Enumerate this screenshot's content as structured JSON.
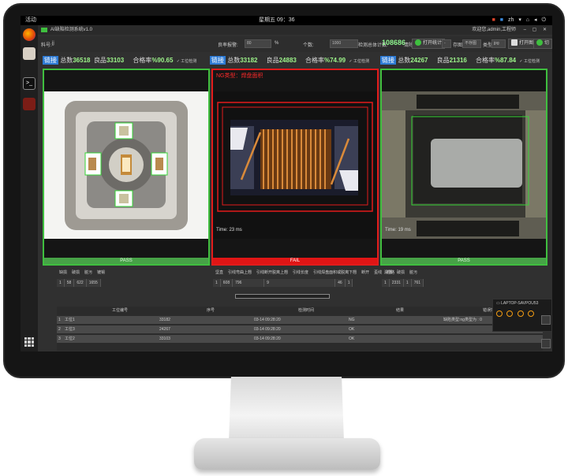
{
  "os": {
    "activities": "活动",
    "clock": "星期五 09：36",
    "tray_items": [
      "zh",
      "▾"
    ]
  },
  "app": {
    "title": "AI缺陷检测系统v1.0",
    "user": "欢迎您,admin,工程师",
    "window_controls": "– ▢ ✕",
    "toolbar": {
      "part_label": "料号:",
      "part_value": "jj",
      "rate_label": "良率报警:",
      "rate_value": "80",
      "rate_unit": "%",
      "count_label": "个数:",
      "count_value": "1000",
      "total_label": "检测总体计数:",
      "total_value": "108686",
      "reset_label": "清除",
      "open_stats": "打开统计",
      "dropdown_value": "-",
      "preview_label": "存图:",
      "preview_value": "不存图",
      "type_label": "类型:",
      "type_value": "jpg",
      "open_image": "打开图片",
      "switch_setting": "切换设置"
    },
    "stations": [
      {
        "tag": "链接",
        "total_label": "总数",
        "total": "36518",
        "good_label": "良品",
        "good": "33103",
        "rate_label": "合格率",
        "rate": "%90.65",
        "check": "工位检测",
        "status": "PASS",
        "ng_type": "",
        "time": ""
      },
      {
        "tag": "链接",
        "total_label": "总数",
        "total": "33182",
        "good_label": "良品",
        "good": "24883",
        "rate_label": "合格率",
        "rate": "%74.99",
        "check": "工位检测",
        "status": "FAIL",
        "ng_type": "NG类型：焊盘面积",
        "time": "Time: 23 ms"
      },
      {
        "tag": "链接",
        "total_label": "总数",
        "total": "24267",
        "good_label": "良品",
        "good": "21316",
        "rate_label": "合格率",
        "rate": "%87.84",
        "check": "工位检测",
        "status": "PASS",
        "ng_type": "",
        "time": "Time: 19 ms"
      }
    ],
    "table1": {
      "headers": [
        "缺损",
        "破损",
        "脏污",
        "镀锡"
      ],
      "row": [
        "1",
        "58",
        "622",
        "1655"
      ]
    },
    "table2": {
      "headers": [
        "坚直",
        "引线弯曲上翘",
        "引线断开脱离上翘",
        "引线长度",
        "引线焊盘面积或脱离下翘",
        "断开",
        "歪线",
        "短路"
      ],
      "row": [
        "1",
        "608",
        "796",
        "",
        "9",
        "",
        "",
        "46",
        "1"
      ]
    },
    "table3": {
      "headers": [
        "漏镀",
        "破损",
        "脏污"
      ],
      "row": [
        "1",
        "2331",
        "1",
        "761"
      ]
    },
    "log": {
      "headers": [
        "工位编号",
        "序号",
        "检测时间",
        "结果",
        "错误描述"
      ],
      "rows": [
        {
          "idx": "1",
          "station": "工位1",
          "seq": "33182",
          "time": "03-14 09:28:20",
          "result": "NG",
          "desc": "缺陷类型:ng类型为 : 0"
        },
        {
          "idx": "2",
          "station": "工位3",
          "seq": "24267",
          "time": "03-14 09:28:20",
          "result": "OK",
          "desc": ""
        },
        {
          "idx": "3",
          "station": "工位2",
          "seq": "33103",
          "time": "03-14 09:28:20",
          "result": "OK",
          "desc": ""
        }
      ]
    },
    "popup": {
      "host": "LAPTOP-SAVPOU53"
    }
  },
  "colors": {
    "pass": "#47a247",
    "fail": "#e01515",
    "accent_green": "#9df58a",
    "tag_blue": "#2d7ad4"
  }
}
